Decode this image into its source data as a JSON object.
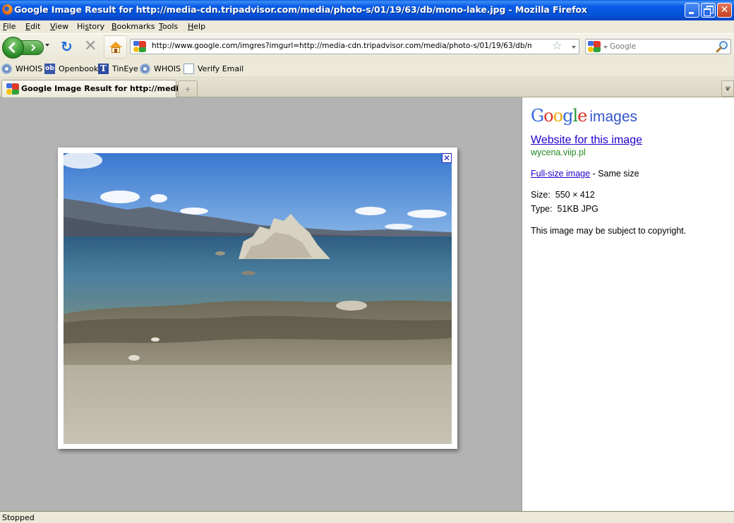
{
  "window": {
    "title": "Google Image Result for http://media-cdn.tripadvisor.com/media/photo-s/01/19/63/db/mono-lake.jpg - Mozilla Firefox",
    "controls": {
      "minimize": "minimize",
      "maximize": "restore",
      "close": "close"
    }
  },
  "menu": [
    {
      "label": "File",
      "accel": "F"
    },
    {
      "label": "Edit",
      "accel": "E"
    },
    {
      "label": "View",
      "accel": "V"
    },
    {
      "label": "History",
      "accel": "s"
    },
    {
      "label": "Bookmarks",
      "accel": "B"
    },
    {
      "label": "Tools",
      "accel": "T"
    },
    {
      "label": "Help",
      "accel": "H"
    }
  ],
  "navbar": {
    "url": "http://www.google.com/imgres?imgurl=http://media-cdn.tripadvisor.com/media/photo-s/01/19/63/db/mono-lake.jpg&",
    "search_placeholder": "Google",
    "icons": [
      "back-icon",
      "forward-icon",
      "reload-icon",
      "stop-icon",
      "home-icon",
      "bookmark-star-icon",
      "search-magnifier-icon"
    ]
  },
  "bookmarks": [
    {
      "label": "WHOIS",
      "icon": "gear-icon"
    },
    {
      "label": "Openbook",
      "icon": "ob-icon"
    },
    {
      "label": "TinEye",
      "icon": "tineye-icon"
    },
    {
      "label": "WHOIS",
      "icon": "gear-icon"
    },
    {
      "label": "Verify Email",
      "icon": "page-icon"
    }
  ],
  "tabs": [
    {
      "label": "Google Image Result for http://medi...",
      "active": true
    }
  ],
  "new_tab_label": "+",
  "image_panel": {
    "alt": "Mono Lake tufa formation photo",
    "close_label": "✕"
  },
  "sidebar": {
    "logo_word": [
      "G",
      "o",
      "o",
      "g",
      "l",
      "e"
    ],
    "logo_suffix": "images",
    "website_link": "Website for this image",
    "website_domain": "wycena.viip.pl",
    "fullsize_link": "Full-size image",
    "fullsize_note": " - Same size",
    "size_label": "Size:",
    "size_value": "550 × 412",
    "type_label": "Type:",
    "type_value": "51KB JPG",
    "copyright": "This image may be subject to copyright."
  },
  "status": "Stopped",
  "colors": {
    "link": "#2200cc",
    "domain_green": "#228822",
    "xp_title_blue": "#0454da",
    "gray_pane": "#b3b3b3"
  }
}
